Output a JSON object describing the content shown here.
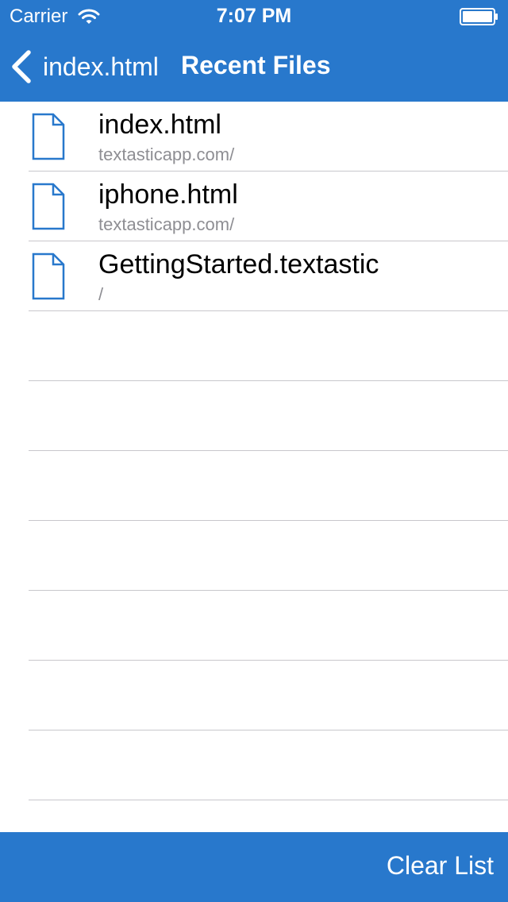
{
  "status_bar": {
    "carrier": "Carrier",
    "time": "7:07 PM",
    "wifi_icon": "wifi-icon",
    "battery_icon": "battery-icon"
  },
  "nav": {
    "back_label": "index.html",
    "title": "Recent Files"
  },
  "files": [
    {
      "name": "index.html",
      "path": "textasticapp.com/",
      "icon": "document-icon"
    },
    {
      "name": "iphone.html",
      "path": "textasticapp.com/",
      "icon": "document-icon"
    },
    {
      "name": "GettingStarted.textastic",
      "path": "/",
      "icon": "document-icon"
    }
  ],
  "toolbar": {
    "clear_label": "Clear List"
  },
  "colors": {
    "accent": "#2878cc",
    "separator": "#c8c7cc",
    "subtitle": "#8e8e93",
    "icon_stroke": "#2878cc"
  }
}
